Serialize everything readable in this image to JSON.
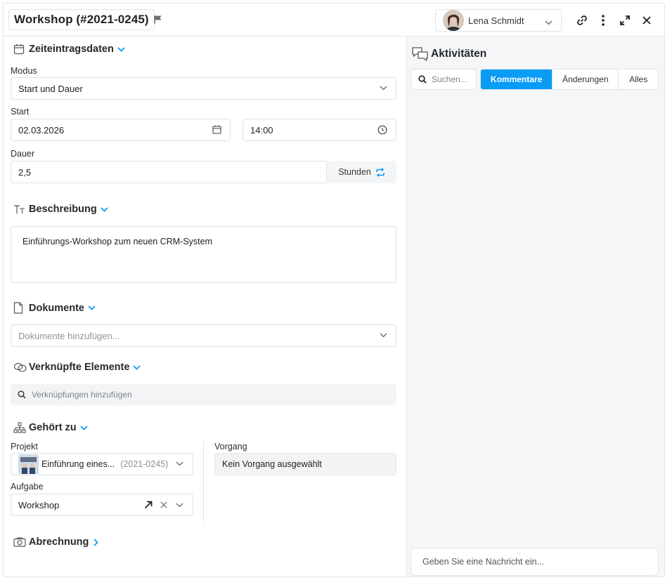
{
  "header": {
    "title": "Workshop (#2021-0245)",
    "user_name": "Lena Schmidt"
  },
  "colors": {
    "accent": "#0a9cf5",
    "panel_bg": "#f5f6f8"
  },
  "sections": {
    "time_entry": {
      "title": "Zeiteintragsdaten",
      "mode_label": "Modus",
      "mode_value": "Start und Dauer",
      "start_label": "Start",
      "start_date": "02.03.2026",
      "start_time": "14:00",
      "duration_label": "Dauer",
      "duration_value": "2,5",
      "duration_unit": "Stunden"
    },
    "description": {
      "title": "Beschreibung",
      "text": "Einführungs-Workshop zum neuen CRM-System"
    },
    "documents": {
      "title": "Dokumente",
      "placeholder": "Dokumente hinzufügen..."
    },
    "linked": {
      "title": "Verknüpfte Elemente",
      "placeholder": "Verknüpfungen hinzufügen"
    },
    "belongs_to": {
      "title": "Gehört zu",
      "project_label": "Projekt",
      "project_name": "Einführung eines...",
      "project_number": "(2021-0245)",
      "process_label": "Vorgang",
      "process_value": "Kein Vorgang ausgewählt",
      "task_label": "Aufgabe",
      "task_value": "Workshop"
    },
    "billing": {
      "title": "Abrechnung"
    }
  },
  "activities": {
    "title": "Aktivitäten",
    "search_placeholder": "Suchen...",
    "tabs": [
      "Kommentare",
      "Änderungen",
      "Alles"
    ],
    "active_tab": "Kommentare",
    "message_placeholder": "Geben Sie eine Nachricht ein..."
  },
  "icons": [
    "flag-icon",
    "link-icon",
    "more-vertical-icon",
    "expand-icon",
    "close-icon",
    "calendar-icon",
    "clock-icon",
    "refresh-icon",
    "text-icon",
    "document-icon",
    "link-chain-icon",
    "hierarchy-icon",
    "camera-icon",
    "chat-icon",
    "search-icon",
    "chevron-down-icon"
  ]
}
